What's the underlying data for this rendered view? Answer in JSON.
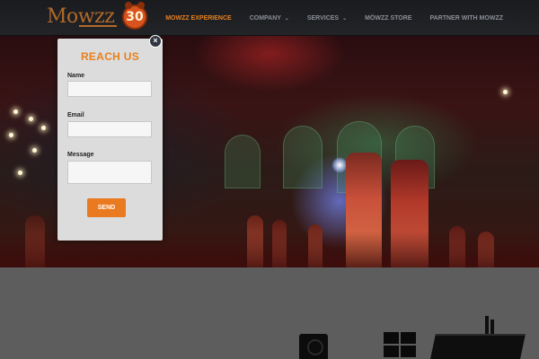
{
  "header": {
    "logo_text": "Mowzz",
    "logo_badge": "30",
    "nav": [
      {
        "label": "MOWZZ EXPERIENCE",
        "active": true,
        "has_dropdown": false
      },
      {
        "label": "COMPANY",
        "active": false,
        "has_dropdown": true
      },
      {
        "label": "SERVICES",
        "active": false,
        "has_dropdown": true
      },
      {
        "label": "MÖWZZ STORE",
        "active": false,
        "has_dropdown": false
      },
      {
        "label": "PARTNER WITH MOWZZ",
        "active": false,
        "has_dropdown": false
      }
    ],
    "caret_glyph": "⌄"
  },
  "modal": {
    "title": "REACH US",
    "close_glyph": "×",
    "name_label": "Name",
    "name_value": "",
    "email_label": "Email",
    "email_value": "",
    "message_label": "Message",
    "message_value": "",
    "send_label": "SEND"
  },
  "colors": {
    "accent": "#e8801e",
    "header_bg": "#1e1f23",
    "modal_bg": "#dcdcdc",
    "lower_bg": "#5d5d5d"
  },
  "icons": [
    "close-icon",
    "caret-down-icon",
    "speaker-icon",
    "grid-icon",
    "mixer-icon"
  ]
}
